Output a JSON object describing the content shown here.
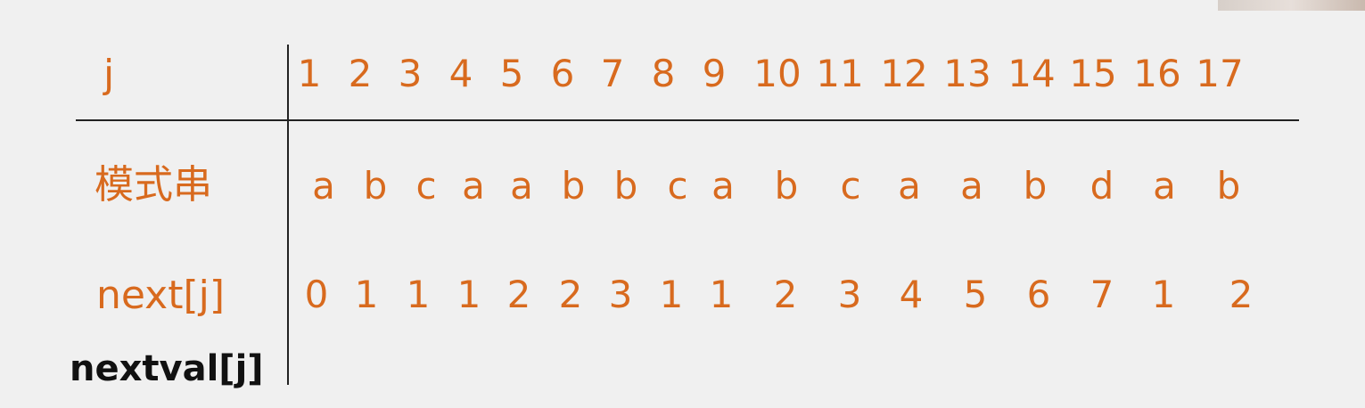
{
  "table": {
    "row_labels": {
      "j": "j",
      "pattern": "模式串",
      "next": "next[j]",
      "nextval": "nextval[j]"
    },
    "j_values": [
      "1",
      "2",
      "3",
      "4",
      "5",
      "6",
      "7",
      "8",
      "9",
      "10",
      "11",
      "12",
      "13",
      "14",
      "15",
      "16",
      "17"
    ],
    "pattern_chars": [
      "a",
      "b",
      "c",
      "a",
      "a",
      "b",
      "b",
      "c",
      "a",
      "b",
      "c",
      "a",
      "a",
      "b",
      "d",
      "a",
      "b"
    ],
    "next_values": [
      "0",
      "1",
      "1",
      "1",
      "2",
      "2",
      "3",
      "1",
      "1",
      "2",
      "3",
      "4",
      "5",
      "6",
      "7",
      "1",
      "2"
    ]
  },
  "colors": {
    "accent": "#d86a1e",
    "line": "#222222",
    "background": "#f0f0f0"
  }
}
